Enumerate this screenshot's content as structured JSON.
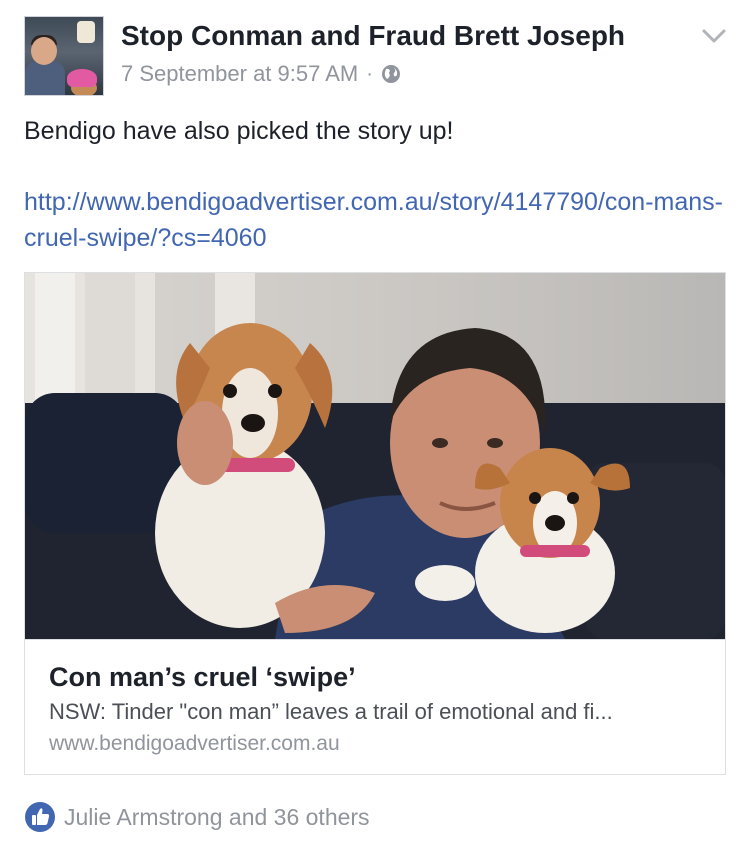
{
  "post": {
    "author": "Stop Conman and Fraud Brett Joseph",
    "timestamp": "7 September at 9:57 AM",
    "separator": "·",
    "privacy_icon": "globe-icon",
    "menu_icon": "chevron-down-icon",
    "text": "Bendigo have also picked the story up!",
    "link": "http://www.bendigoadvertiser.com.au/story/4147790/con-mans-cruel-swipe/?cs=4060"
  },
  "link_preview": {
    "title": "Con man’s cruel ‘swipe’",
    "description": "NSW: Tinder \"con man” leaves a trail of emotional and fi...",
    "domain": "www.bendigoadvertiser.com.au",
    "image": "photo-man-with-two-dogs"
  },
  "reactions": {
    "icon": "like-icon",
    "text": "Julie Armstrong and 36 others"
  },
  "colors": {
    "link": "#4267b2",
    "meta": "#90949c",
    "like_badge": "#4267b2"
  }
}
